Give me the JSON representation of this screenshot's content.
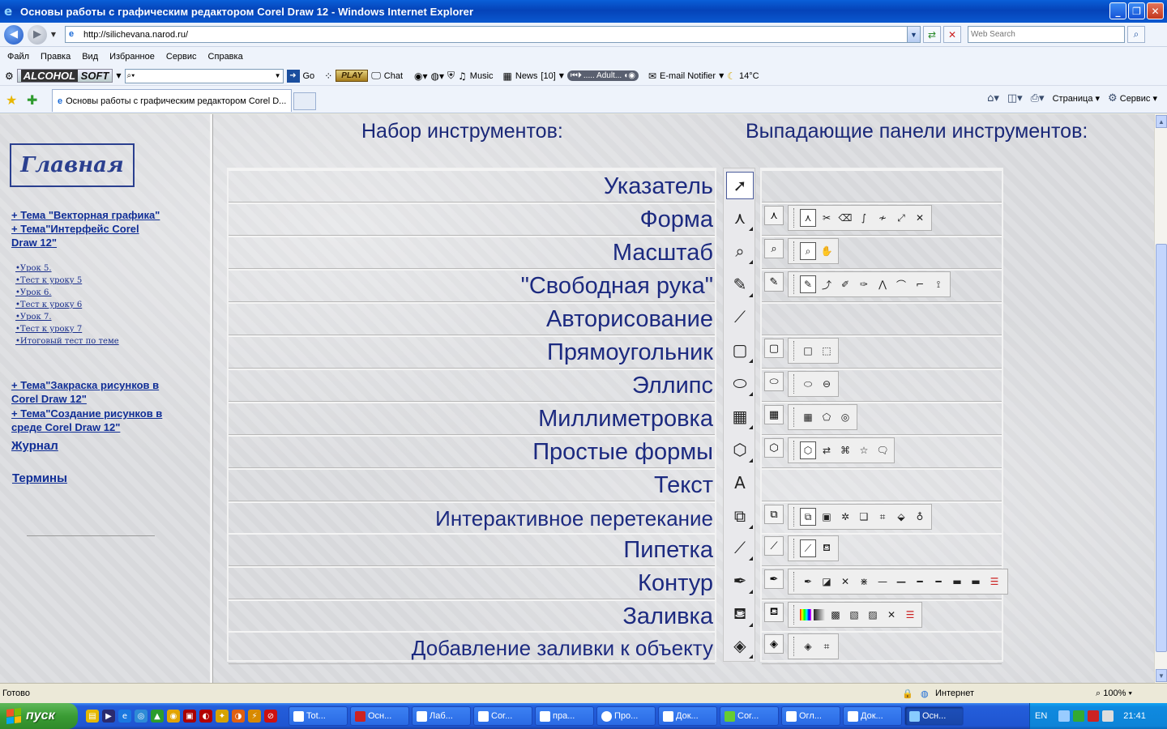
{
  "window": {
    "title": "Основы работы с графическим редактором Corel Draw 12 - Windows Internet Explorer",
    "buttons": [
      "_",
      "❐",
      "✕"
    ]
  },
  "address_bar": {
    "url": "http://silichevana.narod.ru/",
    "search_placeholder": "Web Search"
  },
  "menu": [
    "Файл",
    "Правка",
    "Вид",
    "Избранное",
    "Сервис",
    "Справка"
  ],
  "toolbar2": {
    "brand": "ALCOHOL",
    "brand2": "SOFT",
    "go": "Go",
    "play": "PLAY",
    "chat": "Chat",
    "music": "Music",
    "news": "News",
    "news_count": "[10]",
    "player_text": "..... Adult...",
    "email": "E-mail Notifier",
    "weather": "14°C"
  },
  "tabs": {
    "active_title": "Основы работы с графическим редактором Corel D...",
    "commands": [
      "Страница",
      "Сервис"
    ]
  },
  "sidebar": {
    "home_label": "Главная",
    "topic_links": [
      "+ Тема \"Векторная графика\"",
      "+ Тема\"Интерфейс Corel Draw 12\""
    ],
    "sub_links": [
      "•Урок 5.",
      "•Тест к уроку 5",
      "•Урок 6.",
      "•Тест к уроку 6",
      "•Урок 7.",
      "•Тест к уроку 7",
      "•Итоговый тест по теме"
    ],
    "topic_links2": [
      "+ Тема\"Закраска рисунков в Corel Draw 12\"",
      "+ Тема\"Создание рисунков в среде Corel Draw 12\""
    ],
    "journal": "Журнал",
    "terms": "Термины"
  },
  "main": {
    "heading_tools": "Набор инструментов:",
    "heading_flyouts": "Выпадающие панели инструментов:",
    "tools": [
      {
        "label": "Указатель",
        "icon": "pointer-icon"
      },
      {
        "label": "Форма",
        "icon": "shape-icon"
      },
      {
        "label": "Масштаб",
        "icon": "zoom-icon"
      },
      {
        "label": "\"Свободная рука\"",
        "icon": "freehand-icon"
      },
      {
        "label": "Авторисование",
        "icon": "smartdraw-icon"
      },
      {
        "label": "Прямоугольник",
        "icon": "rectangle-icon"
      },
      {
        "label": "Эллипс",
        "icon": "ellipse-icon"
      },
      {
        "label": "Миллиметровка",
        "icon": "graph-paper-icon"
      },
      {
        "label": "Простые формы",
        "icon": "basic-shapes-icon"
      },
      {
        "label": "Текст",
        "icon": "text-icon"
      },
      {
        "label": "Интерактивное перетекание",
        "icon": "blend-icon"
      },
      {
        "label": "Пипетка",
        "icon": "eyedropper-icon"
      },
      {
        "label": "Контур",
        "icon": "outline-pen-icon"
      },
      {
        "label": "Заливка",
        "icon": "fill-bucket-icon"
      },
      {
        "label": "Добавление заливки к объекту",
        "icon": "interactive-fill-icon"
      }
    ]
  },
  "status": {
    "left": "Готово",
    "zone": "Интернет",
    "zoom": "100%"
  },
  "taskbar": {
    "start": "пуск",
    "buttons": [
      "Tot...",
      "Осн...",
      "Лаб...",
      "Cor...",
      "пра...",
      "Про...",
      "Док...",
      "Cor...",
      "Огл...",
      "Док...",
      "Осн..."
    ],
    "lang": "EN",
    "clock": "21:41"
  }
}
